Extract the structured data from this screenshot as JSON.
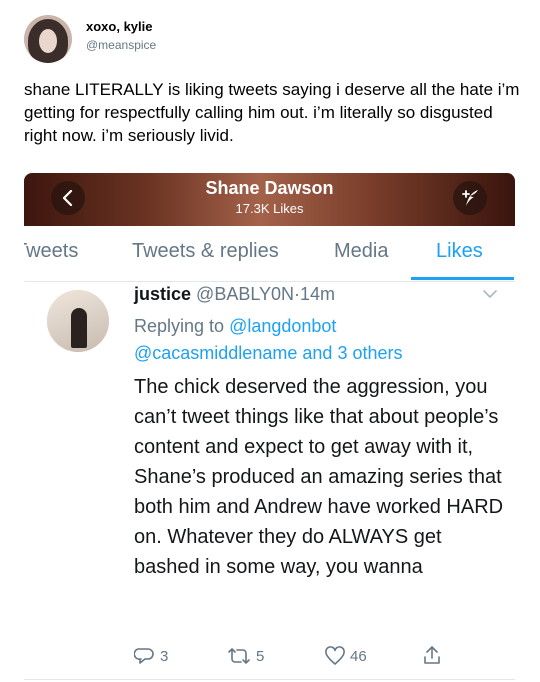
{
  "outer_tweet": {
    "display_name": "xoxo, kylie",
    "handle": "@meanspice",
    "text": "shane LITERALLY is liking tweets saying i deserve all the hate i’m getting for respectfully calling him out. i’m literally so disgusted right now. i’m seriously livid."
  },
  "profile": {
    "name": "Shane Dawson",
    "likes": "17.3K Likes"
  },
  "tabs": [
    {
      "label": "Tweets"
    },
    {
      "label": "Tweets & replies"
    },
    {
      "label": "Media"
    },
    {
      "label": "Likes",
      "active": true
    }
  ],
  "liked_tweet": {
    "author_name": "justice",
    "author_handle": "@BABLY0N",
    "separator": "·",
    "time": "14m",
    "replying_prefix": "Replying to",
    "replying_to_1": "@langdonbot",
    "replying_to_2": "@cacasmiddlename",
    "replying_and": "and",
    "replying_others": "3 others",
    "text": "The chick deserved the aggression, you can’t tweet things like that about people’s content and expect to get away with it, Shane’s produced an amazing series that both him and Andrew have worked HARD on. Whatever they do ALWAYS get bashed in some way, you wanna",
    "replies": "3",
    "retweets": "5",
    "likes": "46"
  },
  "colors": {
    "accent": "#1da1f2",
    "muted": "#657786"
  },
  "icons": [
    "back-arrow-icon",
    "compose-tweet-icon",
    "chevron-down-icon",
    "reply-icon",
    "retweet-icon",
    "like-heart-icon",
    "share-icon"
  ]
}
